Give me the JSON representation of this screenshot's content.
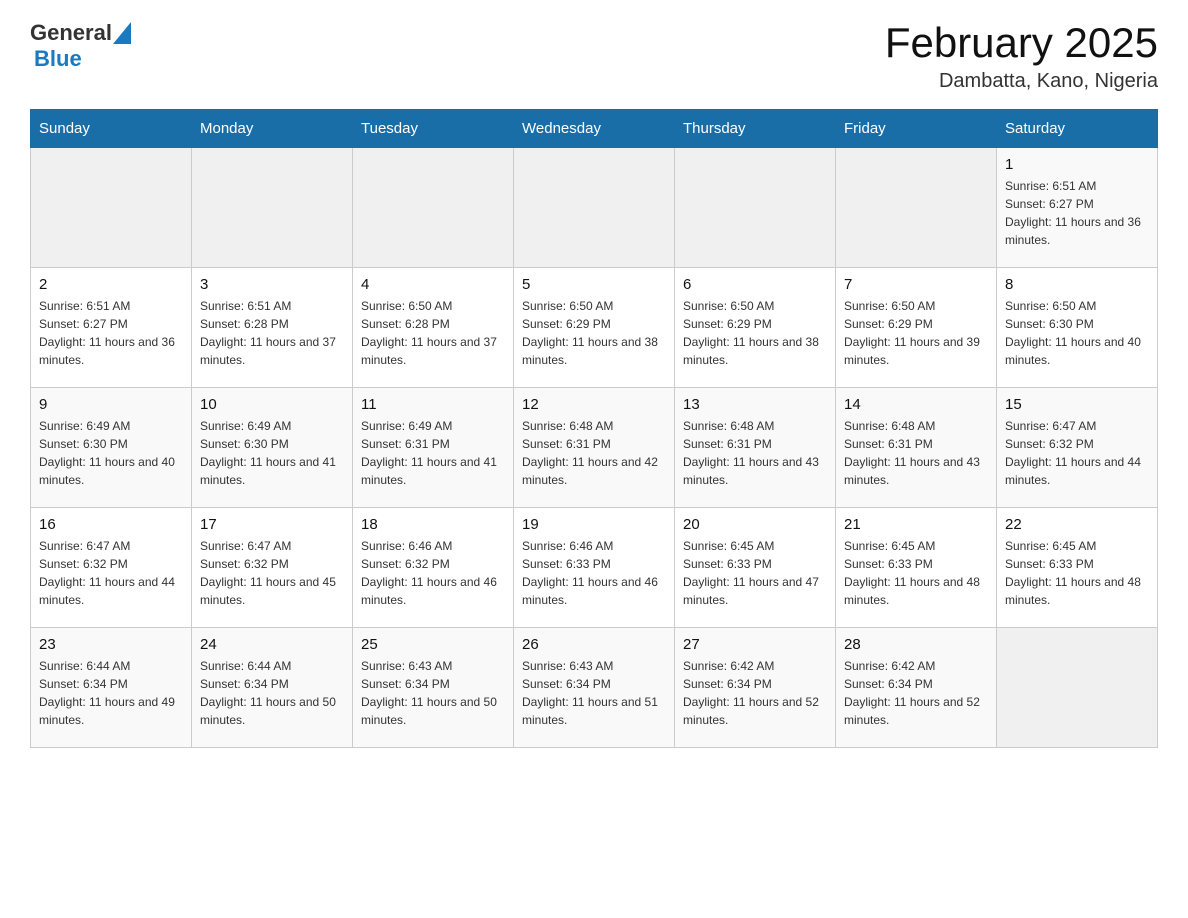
{
  "header": {
    "logo_general": "General",
    "logo_blue": "Blue",
    "title": "February 2025",
    "subtitle": "Dambatta, Kano, Nigeria"
  },
  "days_of_week": [
    "Sunday",
    "Monday",
    "Tuesday",
    "Wednesday",
    "Thursday",
    "Friday",
    "Saturday"
  ],
  "weeks": [
    [
      {
        "day": "",
        "info": ""
      },
      {
        "day": "",
        "info": ""
      },
      {
        "day": "",
        "info": ""
      },
      {
        "day": "",
        "info": ""
      },
      {
        "day": "",
        "info": ""
      },
      {
        "day": "",
        "info": ""
      },
      {
        "day": "1",
        "info": "Sunrise: 6:51 AM\nSunset: 6:27 PM\nDaylight: 11 hours and 36 minutes."
      }
    ],
    [
      {
        "day": "2",
        "info": "Sunrise: 6:51 AM\nSunset: 6:27 PM\nDaylight: 11 hours and 36 minutes."
      },
      {
        "day": "3",
        "info": "Sunrise: 6:51 AM\nSunset: 6:28 PM\nDaylight: 11 hours and 37 minutes."
      },
      {
        "day": "4",
        "info": "Sunrise: 6:50 AM\nSunset: 6:28 PM\nDaylight: 11 hours and 37 minutes."
      },
      {
        "day": "5",
        "info": "Sunrise: 6:50 AM\nSunset: 6:29 PM\nDaylight: 11 hours and 38 minutes."
      },
      {
        "day": "6",
        "info": "Sunrise: 6:50 AM\nSunset: 6:29 PM\nDaylight: 11 hours and 38 minutes."
      },
      {
        "day": "7",
        "info": "Sunrise: 6:50 AM\nSunset: 6:29 PM\nDaylight: 11 hours and 39 minutes."
      },
      {
        "day": "8",
        "info": "Sunrise: 6:50 AM\nSunset: 6:30 PM\nDaylight: 11 hours and 40 minutes."
      }
    ],
    [
      {
        "day": "9",
        "info": "Sunrise: 6:49 AM\nSunset: 6:30 PM\nDaylight: 11 hours and 40 minutes."
      },
      {
        "day": "10",
        "info": "Sunrise: 6:49 AM\nSunset: 6:30 PM\nDaylight: 11 hours and 41 minutes."
      },
      {
        "day": "11",
        "info": "Sunrise: 6:49 AM\nSunset: 6:31 PM\nDaylight: 11 hours and 41 minutes."
      },
      {
        "day": "12",
        "info": "Sunrise: 6:48 AM\nSunset: 6:31 PM\nDaylight: 11 hours and 42 minutes."
      },
      {
        "day": "13",
        "info": "Sunrise: 6:48 AM\nSunset: 6:31 PM\nDaylight: 11 hours and 43 minutes."
      },
      {
        "day": "14",
        "info": "Sunrise: 6:48 AM\nSunset: 6:31 PM\nDaylight: 11 hours and 43 minutes."
      },
      {
        "day": "15",
        "info": "Sunrise: 6:47 AM\nSunset: 6:32 PM\nDaylight: 11 hours and 44 minutes."
      }
    ],
    [
      {
        "day": "16",
        "info": "Sunrise: 6:47 AM\nSunset: 6:32 PM\nDaylight: 11 hours and 44 minutes."
      },
      {
        "day": "17",
        "info": "Sunrise: 6:47 AM\nSunset: 6:32 PM\nDaylight: 11 hours and 45 minutes."
      },
      {
        "day": "18",
        "info": "Sunrise: 6:46 AM\nSunset: 6:32 PM\nDaylight: 11 hours and 46 minutes."
      },
      {
        "day": "19",
        "info": "Sunrise: 6:46 AM\nSunset: 6:33 PM\nDaylight: 11 hours and 46 minutes."
      },
      {
        "day": "20",
        "info": "Sunrise: 6:45 AM\nSunset: 6:33 PM\nDaylight: 11 hours and 47 minutes."
      },
      {
        "day": "21",
        "info": "Sunrise: 6:45 AM\nSunset: 6:33 PM\nDaylight: 11 hours and 48 minutes."
      },
      {
        "day": "22",
        "info": "Sunrise: 6:45 AM\nSunset: 6:33 PM\nDaylight: 11 hours and 48 minutes."
      }
    ],
    [
      {
        "day": "23",
        "info": "Sunrise: 6:44 AM\nSunset: 6:34 PM\nDaylight: 11 hours and 49 minutes."
      },
      {
        "day": "24",
        "info": "Sunrise: 6:44 AM\nSunset: 6:34 PM\nDaylight: 11 hours and 50 minutes."
      },
      {
        "day": "25",
        "info": "Sunrise: 6:43 AM\nSunset: 6:34 PM\nDaylight: 11 hours and 50 minutes."
      },
      {
        "day": "26",
        "info": "Sunrise: 6:43 AM\nSunset: 6:34 PM\nDaylight: 11 hours and 51 minutes."
      },
      {
        "day": "27",
        "info": "Sunrise: 6:42 AM\nSunset: 6:34 PM\nDaylight: 11 hours and 52 minutes."
      },
      {
        "day": "28",
        "info": "Sunrise: 6:42 AM\nSunset: 6:34 PM\nDaylight: 11 hours and 52 minutes."
      },
      {
        "day": "",
        "info": ""
      }
    ]
  ],
  "colors": {
    "header_bg": "#1a6ea8",
    "header_text": "#ffffff",
    "border": "#cccccc"
  }
}
